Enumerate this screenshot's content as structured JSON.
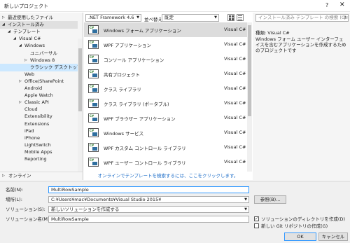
{
  "window": {
    "title": "新しいプロジェクト",
    "help": "?",
    "close": "✕"
  },
  "left_tree": [
    {
      "label": "最近使用したファイル",
      "indent": 0,
      "arrow": "▷",
      "state": "normal"
    },
    {
      "label": "インストール済み",
      "indent": 0,
      "arrow": "◢",
      "state": "header"
    },
    {
      "label": "テンプレート",
      "indent": 1,
      "arrow": "◢",
      "state": "normal"
    },
    {
      "label": "Visual C#",
      "indent": 2,
      "arrow": "◢",
      "state": "normal"
    },
    {
      "label": "Windows",
      "indent": 3,
      "arrow": "◢",
      "state": "normal"
    },
    {
      "label": "ユニバーサル",
      "indent": 4,
      "arrow": "",
      "state": "normal"
    },
    {
      "label": "Windows 8",
      "indent": 4,
      "arrow": "▷",
      "state": "normal"
    },
    {
      "label": "クラシック デスクトップ",
      "indent": 4,
      "arrow": "",
      "state": "selected"
    },
    {
      "label": "Web",
      "indent": 3,
      "arrow": "",
      "state": "normal"
    },
    {
      "label": "Office/SharePoint",
      "indent": 3,
      "arrow": "▷",
      "state": "normal"
    },
    {
      "label": "Android",
      "indent": 3,
      "arrow": "",
      "state": "normal"
    },
    {
      "label": "Apple Watch",
      "indent": 3,
      "arrow": "",
      "state": "normal"
    },
    {
      "label": "Classic API",
      "indent": 3,
      "arrow": "▷",
      "state": "normal"
    },
    {
      "label": "Cloud",
      "indent": 3,
      "arrow": "",
      "state": "normal"
    },
    {
      "label": "Extensibility",
      "indent": 3,
      "arrow": "",
      "state": "normal"
    },
    {
      "label": "Extensions",
      "indent": 3,
      "arrow": "",
      "state": "normal"
    },
    {
      "label": "iPad",
      "indent": 3,
      "arrow": "",
      "state": "normal"
    },
    {
      "label": "iPhone",
      "indent": 3,
      "arrow": "",
      "state": "normal"
    },
    {
      "label": "LightSwitch",
      "indent": 3,
      "arrow": "",
      "state": "normal"
    },
    {
      "label": "Mobile Apps",
      "indent": 3,
      "arrow": "",
      "state": "normal"
    },
    {
      "label": "Reporting",
      "indent": 3,
      "arrow": "",
      "state": "normal"
    }
  ],
  "online": {
    "arrow": "▷",
    "label": "オンライン"
  },
  "toolbar": {
    "framework": ".NET Framework 4.6",
    "sort_label": "並べ替え:",
    "sort_value": "既定"
  },
  "templates": [
    {
      "name": "Windows フォーム アプリケーション",
      "lang": "Visual C#",
      "icon": "winforms-icon"
    },
    {
      "name": "WPF アプリケーション",
      "lang": "Visual C#",
      "icon": "wpf-app-icon"
    },
    {
      "name": "コンソール アプリケーション",
      "lang": "Visual C#",
      "icon": "console-icon"
    },
    {
      "name": "共有プロジェクト",
      "lang": "Visual C#",
      "icon": "shared-project-icon"
    },
    {
      "name": "クラス ライブラリ",
      "lang": "Visual C#",
      "icon": "class-library-icon"
    },
    {
      "name": "クラス ライブラリ (ポータブル)",
      "lang": "Visual C#",
      "icon": "portable-library-icon"
    },
    {
      "name": "WPF ブラウザー アプリケーション",
      "lang": "Visual C#",
      "icon": "wpf-browser-icon"
    },
    {
      "name": "Windows サービス",
      "lang": "Visual C#",
      "icon": "windows-service-icon"
    },
    {
      "name": "WPF カスタム コントロール ライブラリ",
      "lang": "Visual C#",
      "icon": "wpf-custom-control-icon"
    },
    {
      "name": "WPF ユーザー コントロール ライブラリ",
      "lang": "Visual C#",
      "icon": "wpf-user-control-icon"
    }
  ],
  "search_link": "オンラインでテンプレートを検索するには、ここをクリックします。",
  "right": {
    "search_placeholder": "インストール済み テンプレート の検索 (Ctrl-E)",
    "type_line": "種類: Visual C#",
    "description": "Windows フォーム ユーザー インターフェイスを含むアプリケーションを作成するためのプロジェクトです"
  },
  "form": {
    "name_label": "名前(N):",
    "name_value": "MultiRowSample",
    "location_label": "場所(L):",
    "location_value": "C:¥Users¥mac¥Documents¥Visual Studio 2015¥",
    "solution_label": "ソリューション(S):",
    "solution_value": "新しいソリューションを作成する",
    "solution_name_label": "ソリューション名(M):",
    "solution_name_value": "MultiRowSample",
    "browse_button": "参照(B)...",
    "create_dir_label": "ソリューションのディレクトリを作成(D)",
    "create_dir_checked": true,
    "git_label": "新しい Git リポジトリの作成(G)",
    "git_checked": false,
    "ok_button": "OK",
    "cancel_button": "キャンセル"
  }
}
